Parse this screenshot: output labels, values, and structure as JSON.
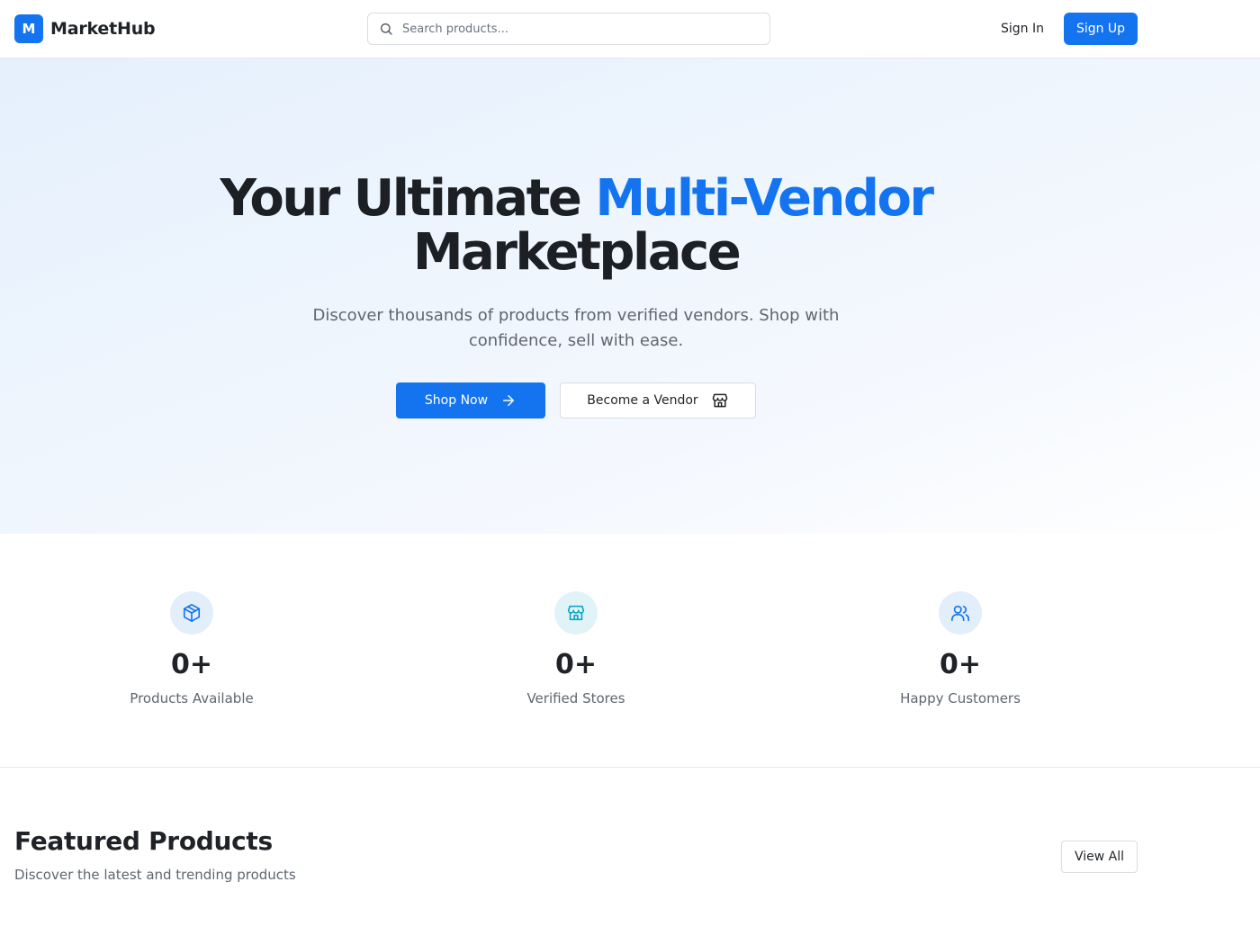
{
  "header": {
    "logo_letter": "M",
    "brand": "MarketHub",
    "search_placeholder": "Search products...",
    "sign_in": "Sign In",
    "sign_up": "Sign Up"
  },
  "hero": {
    "title_part1": "Your Ultimate ",
    "title_accent": "Multi-Vendor",
    "title_part2": "Marketplace",
    "subtitle": "Discover thousands of products from verified vendors. Shop with confidence, sell with ease.",
    "shop_now": "Shop Now",
    "become_vendor": "Become a Vendor"
  },
  "stats": [
    {
      "value": "0+",
      "label": "Products Available",
      "icon": "package-icon"
    },
    {
      "value": "0+",
      "label": "Verified Stores",
      "icon": "store-icon"
    },
    {
      "value": "0+",
      "label": "Happy Customers",
      "icon": "users-icon"
    }
  ],
  "featured": {
    "title": "Featured Products",
    "subtitle": "Discover the latest and trending products",
    "view_all": "View All"
  },
  "colors": {
    "primary": "#1474f0",
    "cyan_accent": "#0ea5c6",
    "icon_bg_blue": "#e3eefb",
    "icon_bg_cyan": "#e0f4f8"
  }
}
